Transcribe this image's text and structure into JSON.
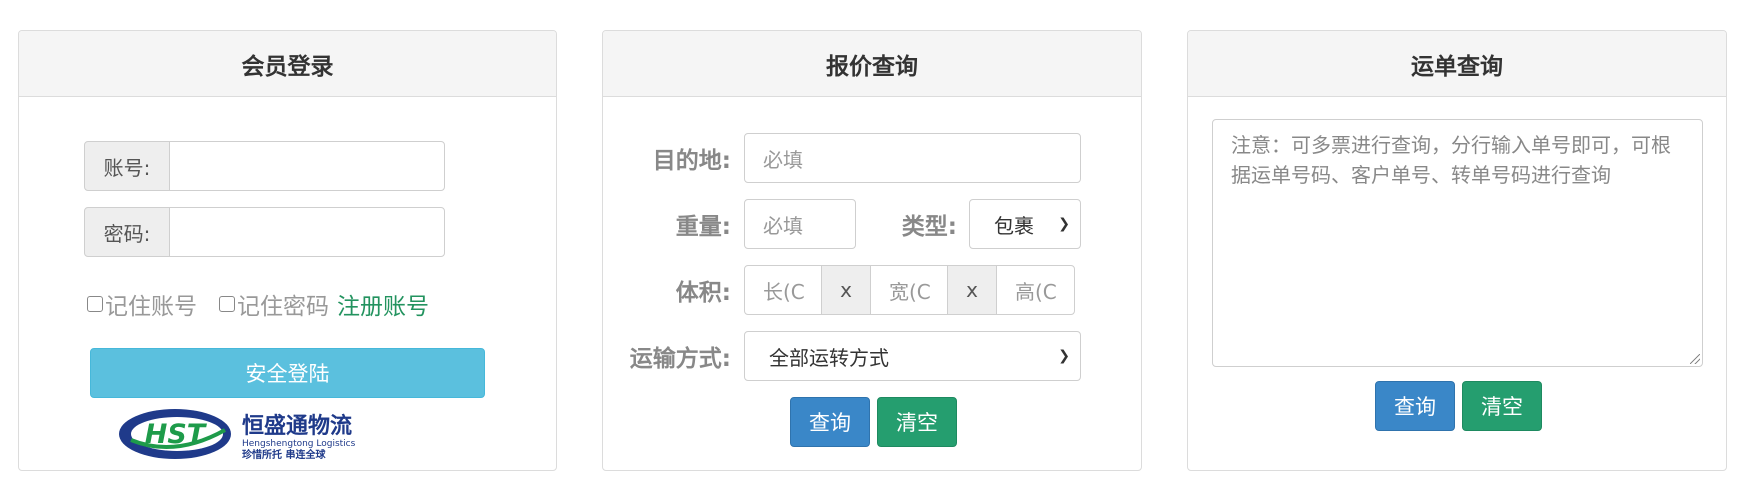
{
  "login": {
    "title": "会员登录",
    "account_label": "账号:",
    "account_value": "",
    "password_label": "密码:",
    "password_value": "",
    "remember_account": "记住账号",
    "remember_password": "记住密码",
    "register_link": "注册账号",
    "login_button": "安全登陆",
    "logo": {
      "abbr": "HST",
      "name_cn": "恒盛通物流",
      "name_en": "Hengshengtong Logistics",
      "slogan": "珍惜所托  串连全球",
      "colors": {
        "blue": "#1f3a8a",
        "green": "#1e9b4a"
      }
    }
  },
  "quote": {
    "title": "报价查询",
    "destination_label": "目的地:",
    "destination_placeholder": "必填",
    "weight_label": "重量:",
    "weight_placeholder": "必填",
    "type_label": "类型:",
    "type_selected": "包裹",
    "volume_label": "体积:",
    "length_placeholder": "长(C",
    "width_placeholder": "宽(C",
    "height_placeholder": "高(C",
    "times_sign": "x",
    "transport_label": "运输方式:",
    "transport_selected": "全部运转方式",
    "query_button": "查询",
    "clear_button": "清空"
  },
  "tracking": {
    "title": "运单查询",
    "textarea_placeholder": "注意：可多票进行查询，分行输入单号即可，可根据运单号码、客户单号、转单号码进行查询",
    "query_button": "查询",
    "clear_button": "清空"
  },
  "colors": {
    "query_blue": "#3a87c8",
    "clear_green": "#259e6f",
    "login_info": "#5bc0de",
    "link_green": "#23935f"
  }
}
